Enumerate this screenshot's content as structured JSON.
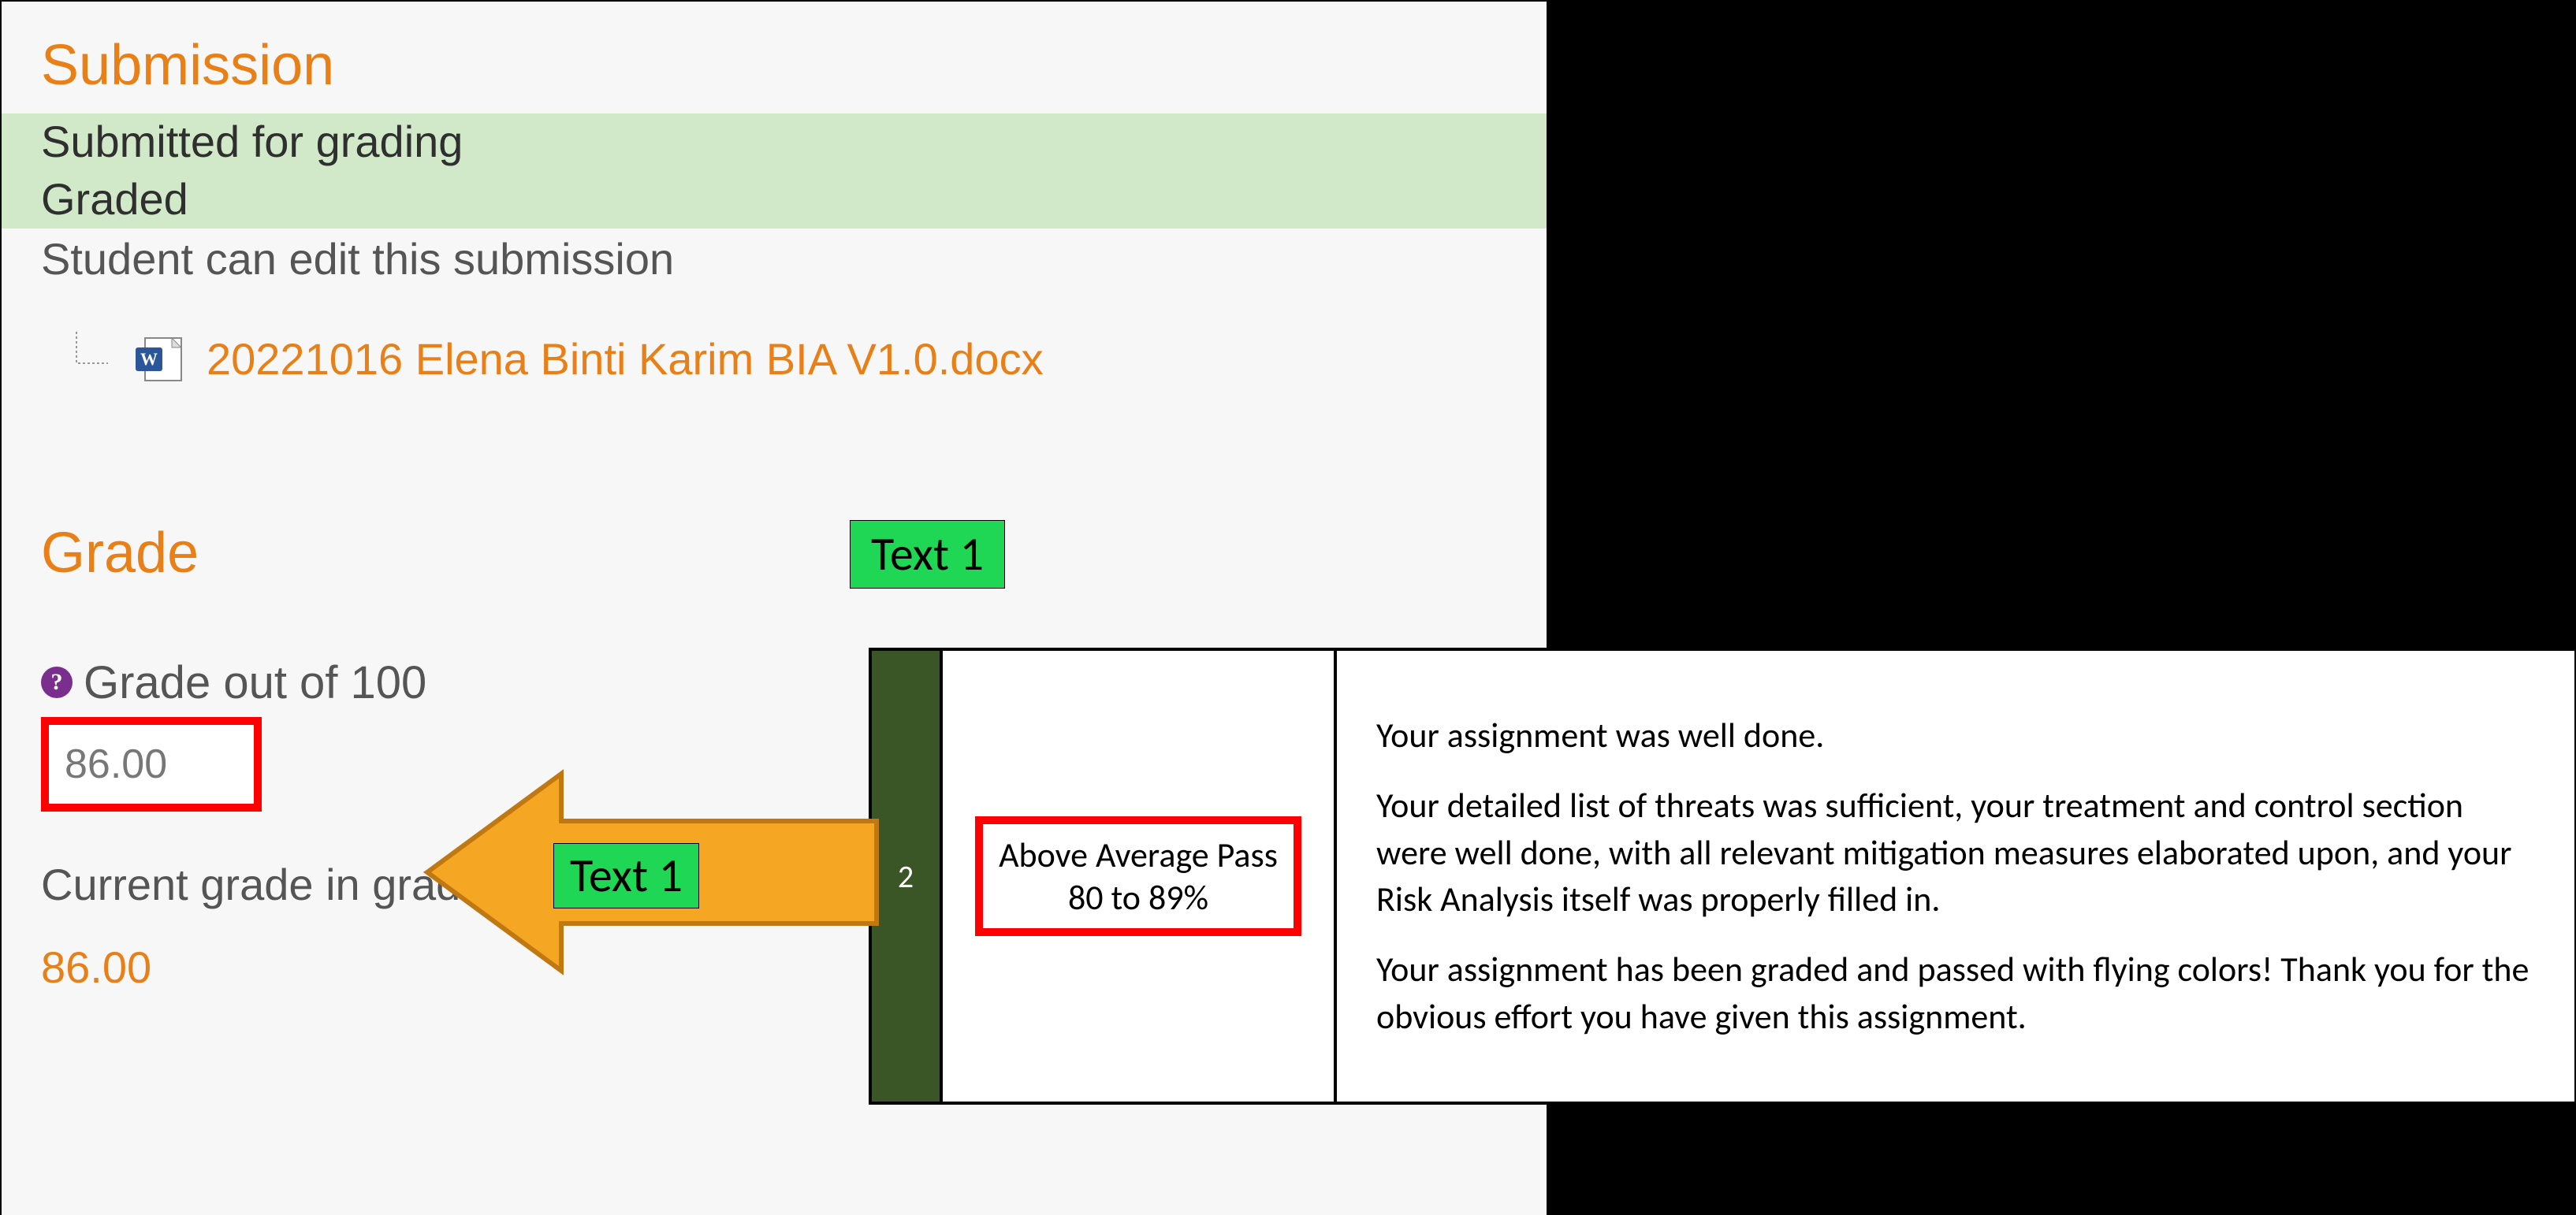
{
  "submission": {
    "heading": "Submission",
    "status1": "Submitted for grading",
    "status2": "Graded",
    "edit_note": "Student can edit this submission",
    "file_name": "20221016 Elena Binti Karim BIA V1.0.docx"
  },
  "grade": {
    "heading": "Grade",
    "label": "Grade out of 100",
    "help_icon_glyph": "?",
    "value": "86.00",
    "current_label": "Current grade in gradebook",
    "current_value": "86.00"
  },
  "annotations": {
    "text1_top_label": "Text 1",
    "text1_arrow_label": "Text 1"
  },
  "feedback": {
    "row_num": "2",
    "band_title": "Above Average Pass",
    "band_range": "80 to 89%",
    "para1": "Your assignment was well done.",
    "para2": "Your detailed list of threats was sufficient, your treatment and control section were well done, with all relevant mitigation measures elaborated upon, and your Risk Analysis itself was properly filled in.",
    "para3": "Your assignment has been graded and passed with flying colors! Thank you for the obvious effort you have given this assignment."
  }
}
